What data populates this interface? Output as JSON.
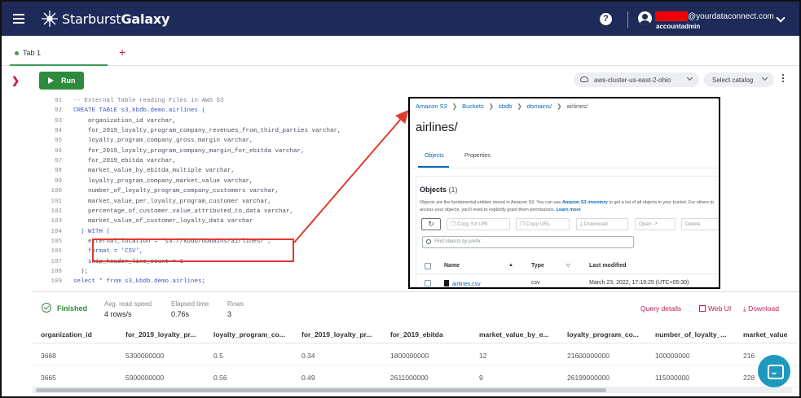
{
  "app": {
    "brand_light": "Starburst",
    "brand_bold": "Galaxy",
    "user_email": "@yourdataconnect.com",
    "user_role": "accountadmin",
    "help_glyph": "?"
  },
  "tabs": [
    {
      "label": "Tab 1"
    }
  ],
  "add_tab_glyph": "+",
  "toolbar": {
    "run_label": "Run",
    "cluster": "aws-cluster-us-east-2-ohio",
    "catalog": "Select catalog"
  },
  "editor": {
    "lines": [
      {
        "n": "91",
        "text": "-- External Table reading Files in AWS S3",
        "kind": "cm"
      },
      {
        "n": "92",
        "text": "CREATE TABLE s3_kbdb.demo.airlines (",
        "kind": "kw"
      },
      {
        "n": "93",
        "text": "    organization_id varchar,",
        "kind": ""
      },
      {
        "n": "94",
        "text": "    for_2019_loyalty_program_company_revenues_from_third_parties varchar,",
        "kind": ""
      },
      {
        "n": "95",
        "text": "    loyalty_program_company_gross_margin varchar,",
        "kind": ""
      },
      {
        "n": "96",
        "text": "    for_2019_loyalty_program_company_margin_for_ebitda varchar,",
        "kind": ""
      },
      {
        "n": "97",
        "text": "    for_2019_ebitda varchar,",
        "kind": ""
      },
      {
        "n": "98",
        "text": "    market_value_by_ebitda_multiple varchar,",
        "kind": ""
      },
      {
        "n": "99",
        "text": "    loyalty_program_company_market_value varchar,",
        "kind": ""
      },
      {
        "n": "100",
        "text": "    number_of_loyalty_program_company_customers varchar,",
        "kind": ""
      },
      {
        "n": "101",
        "text": "    market_value_per_loyalty_program_customer varchar,",
        "kind": ""
      },
      {
        "n": "102",
        "text": "    percentage_of_customer_value_attributed_to_data varchar,",
        "kind": ""
      },
      {
        "n": "103",
        "text": "    market_value_of_customer_loyalty_data varchar",
        "kind": ""
      },
      {
        "n": "104",
        "text": "  ) WITH (",
        "kind": "kw"
      },
      {
        "n": "105",
        "text": "    external_location = 's3://kbdb/domains/airlines/',",
        "kind": ""
      },
      {
        "n": "106",
        "text": "    format = 'CSV',",
        "kind": "kw"
      },
      {
        "n": "107",
        "text": "    skip_header_line_count = 1",
        "kind": ""
      },
      {
        "n": "108",
        "text": "  );",
        "kind": ""
      },
      {
        "n": "109",
        "text": "select * from s3_kbdb.demo.airlines;",
        "kind": "kw"
      }
    ]
  },
  "s3": {
    "crumbs": [
      "Amazon S3",
      "Buckets",
      "kbdb",
      "domains/"
    ],
    "crumb_current": "airlines/",
    "title": "airlines/",
    "tab_objects": "Objects",
    "tab_properties": "Properties",
    "objects_heading": "Objects",
    "objects_count": "(1)",
    "desc_prefix": "Objects are the fundamental entities stored in Amazon S3. You can use",
    "desc_link": "Amazon S3 inventory",
    "desc_suffix": "to get a list of all objects in your bucket. For others to access your objects, you'll need to explicitly grant them permissions.",
    "desc_learn": "Learn more",
    "btn_copy_uri": "Copy S3 URI",
    "btn_copy_url": "Copy URL",
    "btn_download": "Download",
    "btn_open": "Open",
    "btn_delete": "Delete",
    "search_placeholder": "Find objects by prefix",
    "col_name": "Name",
    "col_type": "Type",
    "col_modified": "Last modified",
    "row_name": "airlines.csv",
    "row_type": "csv",
    "row_modified": "March 23, 2022, 17:19:25 (UTC+05:30)"
  },
  "results": {
    "status": "Finished",
    "read_speed_label": "Avg. read speed",
    "read_speed": "4 rows/s",
    "elapsed_label": "Elapsed time",
    "elapsed": "0.76s",
    "rows_label": "Rows",
    "rows": "3",
    "query_details": "Query details",
    "web_ui": "Web UI",
    "download": "Download",
    "columns": [
      "organization_id",
      "for_2019_loyalty_pr...",
      "loyalty_program_co...",
      "for_2019_loyalty_pr...",
      "for_2019_ebitda",
      "market_value_by_e...",
      "loyalty_program_co...",
      "number_of_loyalty_...",
      "market_value"
    ],
    "rows_data": [
      [
        "3668",
        "5300000000",
        "0.5",
        "0.34",
        "1800000000",
        "12",
        "21600000000",
        "100000000",
        "216"
      ],
      [
        "3665",
        "5900000000",
        "0.56",
        "0.49",
        "2611000000",
        "9",
        "26199000000",
        "115000000",
        "228"
      ]
    ]
  },
  "colors": {
    "nav_bg": "#1e2b58",
    "accent_pink": "#c2185b",
    "run_green": "#2e8b3d",
    "annotation_red": "#e03a2f",
    "aws_link": "#0a66b8"
  }
}
